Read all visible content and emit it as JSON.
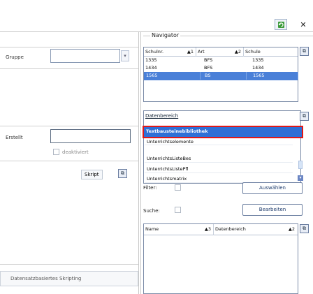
{
  "toolbar": {
    "close_glyph": "✕",
    "refresh_icon": "refresh-icon"
  },
  "left": {
    "gruppe_label": "Gruppe",
    "erstellt_label": "Erstellt",
    "deaktiviert_label": "deaktiviert",
    "skript_label": "Skript",
    "skript_icon_glyph": "⧉",
    "footer_label": "Datensatzbasiertes Skripting"
  },
  "navigator": {
    "title": "Navigator",
    "table1": {
      "columns": [
        {
          "label": "Schulnr.",
          "sort": "▲1"
        },
        {
          "label": "Art",
          "sort": "▲2"
        },
        {
          "label": "Schule",
          "sort": ""
        }
      ],
      "rows": [
        [
          "1335",
          "BFS",
          "1335"
        ],
        [
          "1434",
          "BFS",
          "1434"
        ],
        [
          "1565",
          "BS",
          "1565"
        ]
      ],
      "selected_row": 2
    },
    "dropdown": {
      "header": "Datenbereich",
      "items": [
        "Textbausteinebibliothek",
        "Unterrichtselemente",
        "UnterrichtsListeBes",
        "UnterrichtsListePfl",
        "Unterrichtsmatrix"
      ],
      "highlighted": 0
    },
    "filter_label": "Filter:",
    "suche_label": "Suche:",
    "auswaehlen_btn": "Auswählen",
    "bearbeiten_btn": "Bearbeiten",
    "table2": {
      "columns": [
        {
          "label": "Name",
          "sort": "▲3"
        },
        {
          "label": "Datenbereich",
          "sort": "▲2"
        }
      ]
    },
    "grid_icon_glyph": "⧉"
  }
}
